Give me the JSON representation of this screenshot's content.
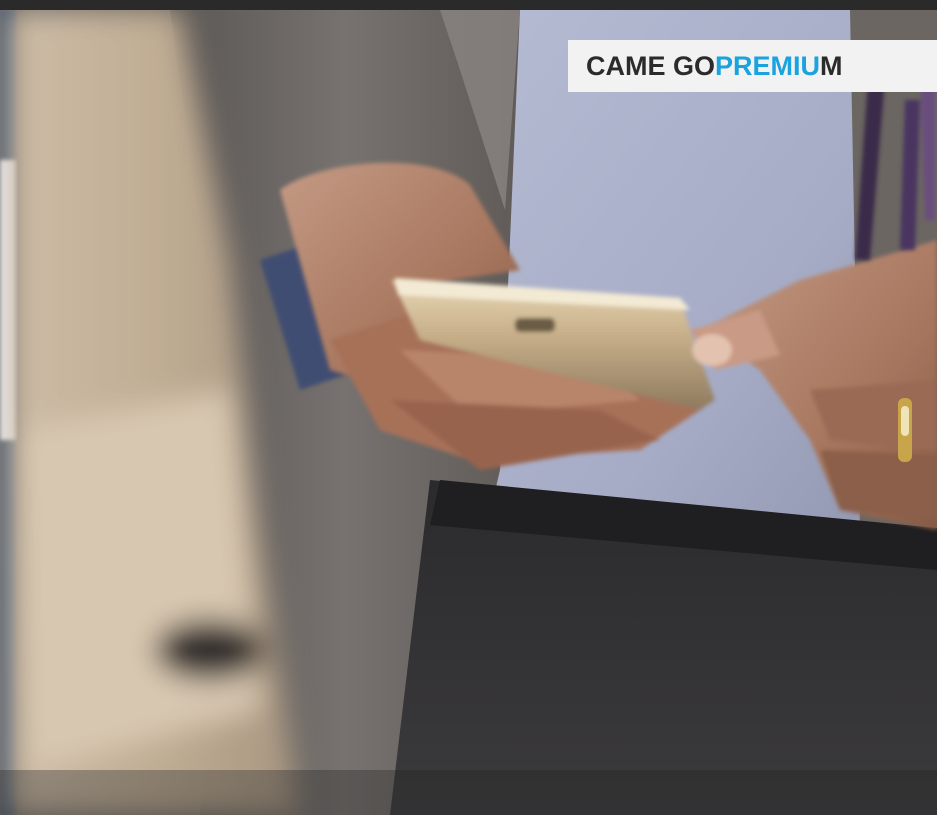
{
  "banner": {
    "segments": [
      {
        "text": "CAME GO ",
        "color": "#2b2b2b"
      },
      {
        "text": "PREMIU",
        "color": "#1aa3de"
      },
      {
        "text": "M",
        "color": "#2b2b2b"
      }
    ]
  },
  "colors": {
    "banner_background": "#f2f2f2",
    "brand_blue": "#1aa3de",
    "banner_text": "#2b2b2b"
  },
  "photo": {
    "subject_icons": [
      "hands-icon",
      "smartphone-icon",
      "eyeglasses-icon",
      "ring-icon"
    ]
  }
}
